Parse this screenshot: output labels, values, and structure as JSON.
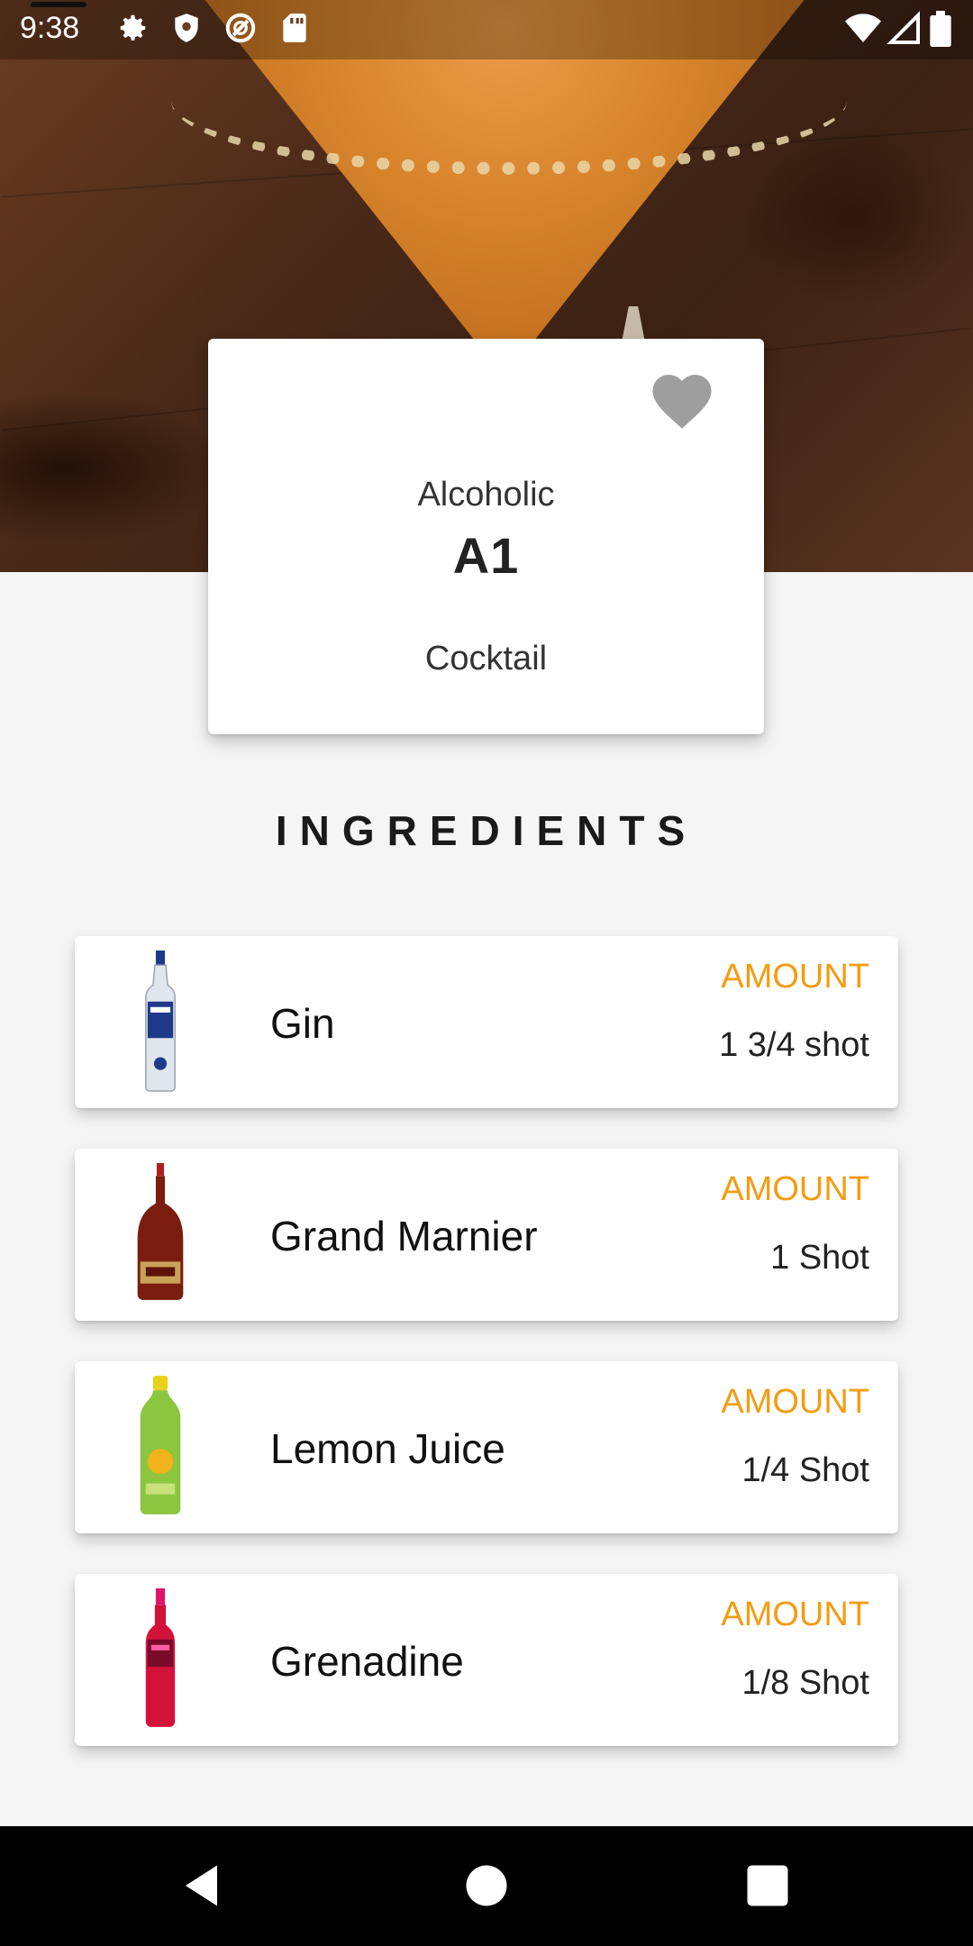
{
  "status_bar": {
    "time": "9:38",
    "left_icons": [
      "gear-icon",
      "shield-icon",
      "sync-icon",
      "sd-card-icon"
    ],
    "right_icons": [
      "wifi-icon",
      "cell-signal-icon",
      "battery-icon"
    ]
  },
  "drink": {
    "category": "Alcoholic",
    "name": "A1",
    "type": "Cocktail",
    "favorite_icon": "heart-icon"
  },
  "ingredients_title": "INGREDIENTS",
  "ingredients": [
    {
      "name": "Gin",
      "amount_label": "AMOUNT",
      "amount": "1 3/4 shot",
      "icon": "gin-bottle-icon"
    },
    {
      "name": "Grand Marnier",
      "amount_label": "AMOUNT",
      "amount": "1 Shot",
      "icon": "grand-marnier-bottle-icon"
    },
    {
      "name": "Lemon Juice",
      "amount_label": "AMOUNT",
      "amount": "1/4 Shot",
      "icon": "lemon-juice-bottle-icon"
    },
    {
      "name": "Grenadine",
      "amount_label": "AMOUNT",
      "amount": "1/8 Shot",
      "icon": "grenadine-bottle-icon"
    }
  ],
  "nav": [
    "back-icon",
    "home-icon",
    "recents-icon"
  ],
  "colors": {
    "accent": "#f39c12",
    "heart": "#9e9e9e",
    "background": "#f5f5f5"
  }
}
